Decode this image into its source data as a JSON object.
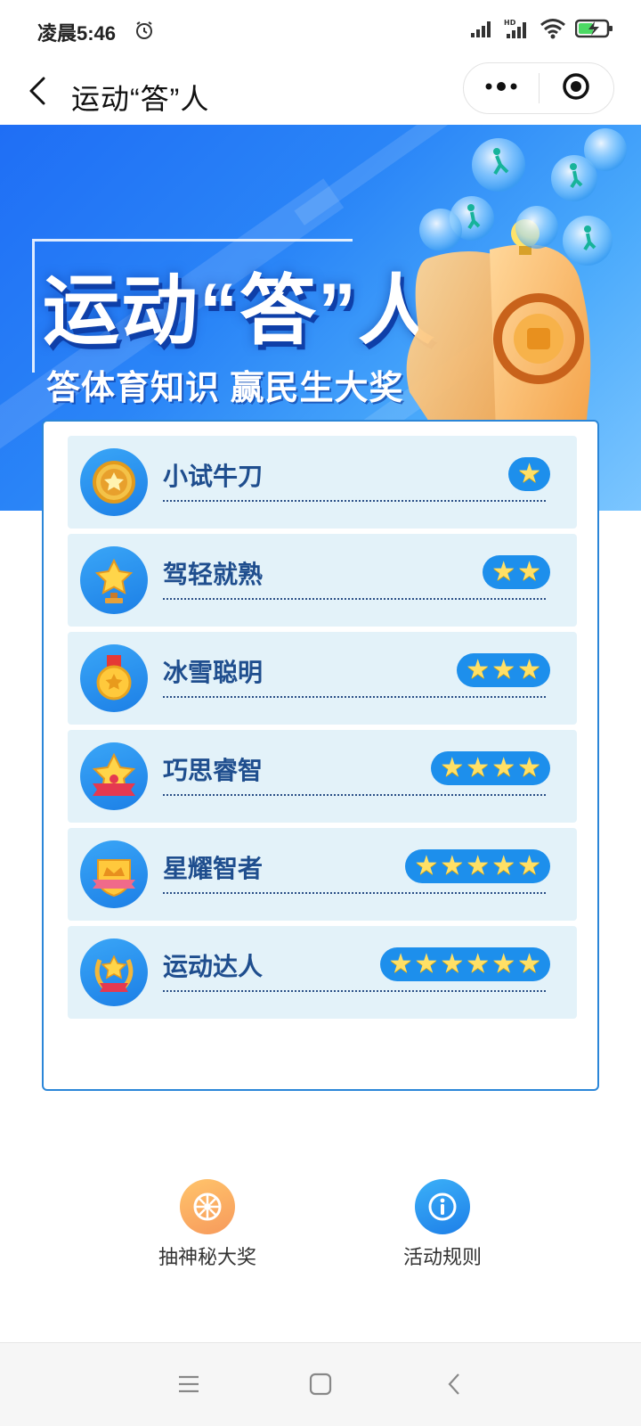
{
  "status_bar": {
    "time": "凌晨5:46",
    "icons": [
      "alarm-icon",
      "signal-icon",
      "hd-signal-icon",
      "wifi-icon",
      "battery-charging-icon"
    ]
  },
  "title_bar": {
    "title": "运动“答”人",
    "back_icon": "chevron-left-icon",
    "more_icon": "more-dots-icon",
    "close_icon": "target-close-icon"
  },
  "banner": {
    "title": "运动“答”人",
    "subtitle": "答体育知识  赢民生大奖"
  },
  "levels": [
    {
      "name": "小试牛刀",
      "stars": 1,
      "badge_icon": "medal-badge-icon"
    },
    {
      "name": "驾轻就熟",
      "stars": 2,
      "badge_icon": "trophy-star-icon"
    },
    {
      "name": "冰雪聪明",
      "stars": 3,
      "badge_icon": "gold-medal-icon"
    },
    {
      "name": "巧思睿智",
      "stars": 4,
      "badge_icon": "star-ribbon-icon"
    },
    {
      "name": "星耀智者",
      "stars": 5,
      "badge_icon": "crown-shield-icon"
    },
    {
      "name": "运动达人",
      "stars": 6,
      "badge_icon": "laurel-wreath-icon"
    }
  ],
  "actions": {
    "lottery_label": "抽神秘大奖",
    "rules_label": "活动规则"
  },
  "colors": {
    "primary_blue": "#1d8fec",
    "row_bg": "#e3f2f9",
    "level_text": "#1f4e8e",
    "lottery_orange": "#f7a563",
    "rules_blue": "#1e8ef0"
  }
}
